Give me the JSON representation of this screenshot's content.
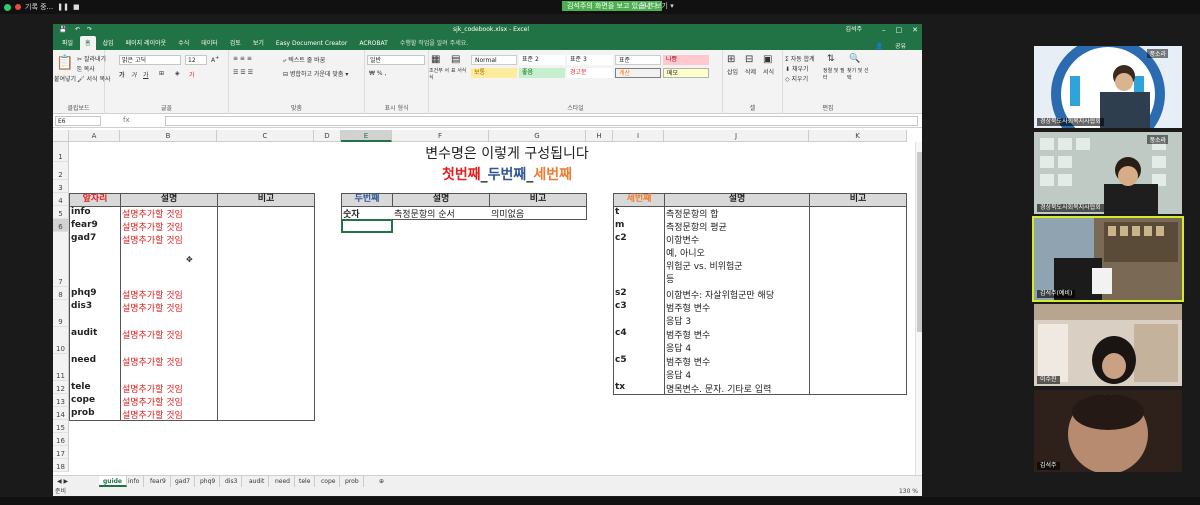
{
  "zoom_bar": {
    "rec_label": "기록 중...",
    "share_notice": "김석주의 화면을 보고 있습니다",
    "view_options": "옵션 보기"
  },
  "excel": {
    "title": "sjk_codebook.xlsx - Excel",
    "user": "김석주",
    "menu_tabs": [
      "파일",
      "홈",
      "삽입",
      "페이지 레이아웃",
      "수식",
      "데이터",
      "검토",
      "보기",
      "Easy Document Creator",
      "ACROBAT",
      "수행할 작업을 알려 주세요."
    ],
    "share_label": "공유",
    "ribbon": {
      "paste": "붙여넣기",
      "cut": "잘라내기",
      "copy": "복사",
      "format_painter": "서식 복사",
      "font_name": "맑은 고딕",
      "font_size": "12",
      "wrap_text": "텍스트 줄 바꿈",
      "merge_center": "병합하고 가운데 맞춤",
      "number_format": "일반",
      "cond_format": "조건부 서식",
      "table_format": "표 서식",
      "cell_styles": [
        "Normal",
        "표준 2",
        "표준 3",
        "표준",
        "나쁨",
        "보통",
        "좋음",
        "경고문",
        "계산",
        "메모"
      ],
      "insert": "삽입",
      "delete": "삭제",
      "format": "서식",
      "autosum": "자동 합계",
      "fill": "채우기",
      "clear": "지우기",
      "sort_filter": "정렬 및 필터",
      "find_select": "찾기 및 선택",
      "group_labels": [
        "클립보드",
        "글꼴",
        "맞춤",
        "표시 형식",
        "스타일",
        "셀",
        "편집"
      ]
    },
    "name_box": "E6",
    "fx": "fx",
    "columns": [
      "A",
      "B",
      "C",
      "D",
      "E",
      "F",
      "G",
      "H",
      "I",
      "J",
      "K"
    ],
    "rows": [
      "1",
      "2",
      "3",
      "4",
      "5",
      "6",
      "7",
      "8",
      "9",
      "10",
      "11",
      "12",
      "13",
      "14",
      "15",
      "16",
      "17",
      "18"
    ],
    "title_line": "변수명은 이렇게 구성됩니다",
    "subtitle": {
      "first": "첫번째",
      "sep1": "_",
      "second": "두번째",
      "sep2": "_",
      "third": "세번째"
    },
    "table1": {
      "headers": [
        "앞자리",
        "설명",
        "비고"
      ],
      "rows": [
        {
          "code": "info",
          "desc": "설명추가할 것임"
        },
        {
          "code": "fear9",
          "desc": "설명추가할 것임"
        },
        {
          "code": "gad7",
          "desc": "설명추가할 것임"
        },
        {
          "code": "phq9",
          "desc": "설명추가할 것임"
        },
        {
          "code": "dis3",
          "desc": "설명추가할 것임"
        },
        {
          "code": "audit",
          "desc": "설명추가할 것임"
        },
        {
          "code": "need",
          "desc": "설명추가할 것임"
        },
        {
          "code": "tele",
          "desc": "설명추가할 것임"
        },
        {
          "code": "cope",
          "desc": "설명추가할 것임"
        },
        {
          "code": "prob",
          "desc": "설명추가할 것임"
        }
      ]
    },
    "table2": {
      "headers": [
        "두번째",
        "설명",
        "비고"
      ],
      "row": {
        "code": "숫자",
        "desc": "측정문항의 순서",
        "note": "의미없음"
      }
    },
    "table3": {
      "headers": [
        "세번째",
        "설명",
        "비고"
      ],
      "rows": [
        {
          "code": "t",
          "lines": [
            "측정문항의 합"
          ]
        },
        {
          "code": "m",
          "lines": [
            "측정문항의 평균"
          ]
        },
        {
          "code": "c2",
          "lines": [
            "이항변수",
            "예, 아니오",
            "위험군 vs. 비위험군",
            "등"
          ]
        },
        {
          "code": "s2",
          "lines": [
            "이항변수: 자살위험군만 해당"
          ]
        },
        {
          "code": "c3",
          "lines": [
            "범주형 변수",
            "응답 3"
          ]
        },
        {
          "code": "c4",
          "lines": [
            "범주형 변수",
            "응답 4"
          ]
        },
        {
          "code": "c5",
          "lines": [
            "범주형 변수",
            "응답 4"
          ]
        },
        {
          "code": "tx",
          "lines": [
            "명목변수. 문자. 기타로 입력"
          ]
        }
      ]
    },
    "sheet_tabs": [
      "guide",
      "info",
      "fear9",
      "gad7",
      "phq9",
      "dis3",
      "audit",
      "need",
      "tele",
      "cope",
      "prob"
    ],
    "status": "준비",
    "zoom": "130 %"
  },
  "participants": [
    {
      "name": "경상북도사회복지사협회",
      "tag": "풍소라"
    },
    {
      "name": "경상북도사회복지사협회",
      "tag": "풍소라"
    },
    {
      "name": "김석주(예비)"
    },
    {
      "name": "이수진"
    },
    {
      "name": "김석주"
    }
  ]
}
